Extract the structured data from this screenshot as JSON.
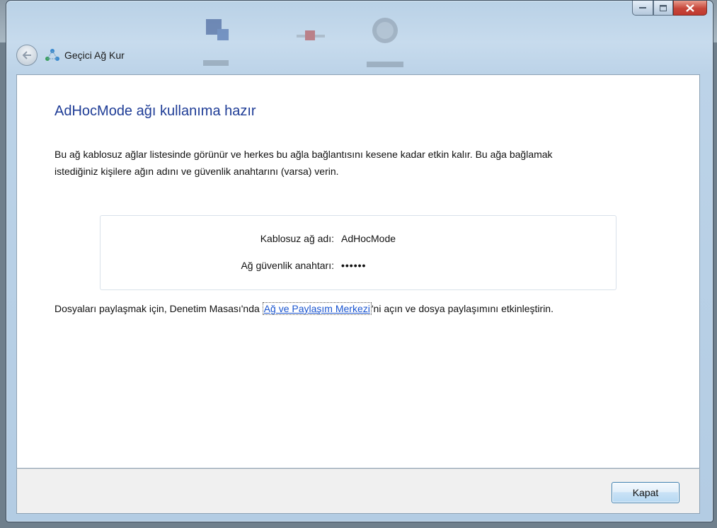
{
  "window": {
    "title": "Geçici Ağ Kur",
    "icons": {
      "back": "back-arrow-icon",
      "wizard": "adhoc-network-icon",
      "minimize": "minimize-icon",
      "maximize": "maximize-icon",
      "close": "close-icon"
    }
  },
  "content": {
    "heading": "AdHocMode ağı kullanıma hazır",
    "description": "Bu ağ kablosuz ağlar listesinde görünür ve herkes bu ağla bağlantısını kesene kadar etkin kalır. Bu ağa bağlamak istediğiniz kişilere ağın adını ve güvenlik anahtarını (varsa) verin.",
    "network_info": {
      "name_label": "Kablosuz ağ adı:",
      "name_value": "AdHocMode",
      "key_label": "Ağ güvenlik anahtarı:",
      "key_value": "••••••"
    },
    "share": {
      "prefix": "Dosyaları paylaşmak için, Denetim Masası'nda ",
      "link": "Ağ ve Paylaşım Merkezi",
      "suffix": "'ni açın ve dosya paylaşımını etkinleştirin."
    }
  },
  "footer": {
    "close_label": "Kapat"
  },
  "colors": {
    "heading": "#1e3c96",
    "link": "#1a55d0",
    "close_caption": "#c6463a"
  }
}
